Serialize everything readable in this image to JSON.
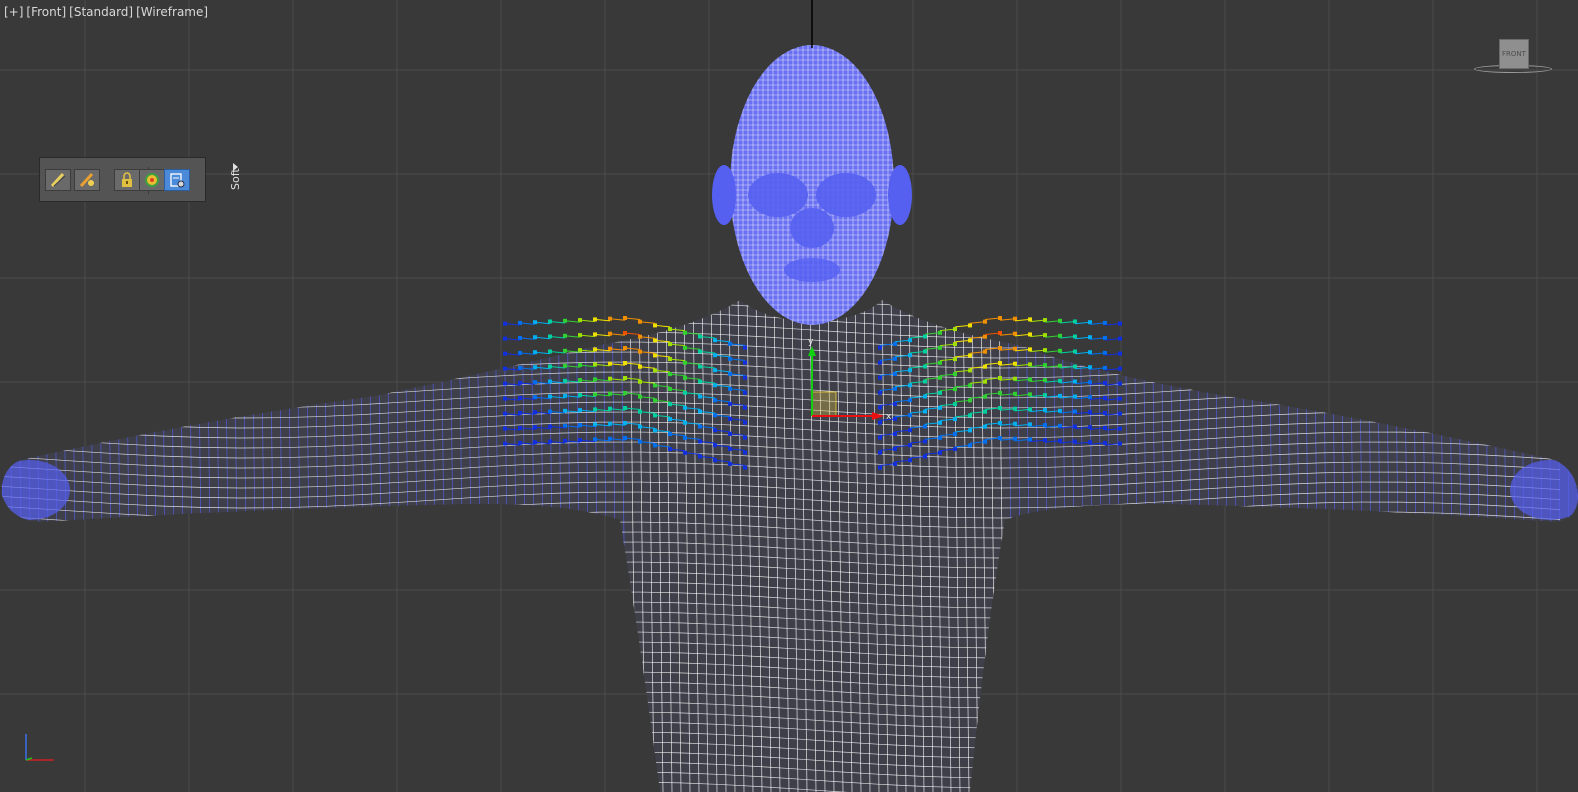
{
  "viewport": {
    "label_parts": [
      "[+]",
      "[Front]",
      "[Standard]",
      "[Wireframe]"
    ]
  },
  "soft_toolbar": {
    "tab_label": "Soft",
    "buttons": [
      {
        "name": "paint-brush-icon",
        "active": false
      },
      {
        "name": "paint-blur-icon",
        "active": false
      },
      {
        "name": "lock-icon",
        "active": false
      },
      {
        "name": "shaded-face-icon",
        "active": false
      },
      {
        "name": "affect-backfacing-icon",
        "active": true
      }
    ]
  },
  "viewcube": {
    "face_label": "FRONT"
  },
  "gizmo": {
    "axis_x_label": "x",
    "axis_y_label": "y"
  },
  "colors": {
    "background": "#393939",
    "grid": "#4a4a4a",
    "wire": "#ffffff",
    "mesh": "#5560f0",
    "gizmo_x": "#e81010",
    "gizmo_y": "#10d010",
    "selection": "#d8c040"
  }
}
